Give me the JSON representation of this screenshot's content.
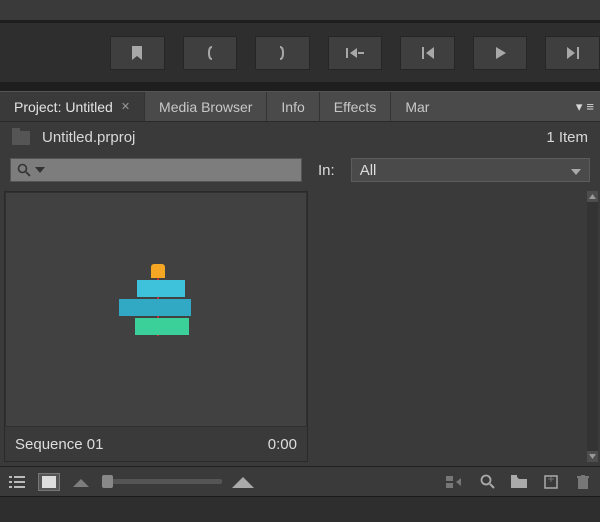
{
  "toolbar": {
    "buttons": [
      "marker",
      "brace-open",
      "brace-close",
      "step-back",
      "prev-frame",
      "play",
      "next-frame"
    ]
  },
  "tabs": {
    "items": [
      {
        "label": "Project: Untitled",
        "active": true,
        "closable": true
      },
      {
        "label": "Media Browser",
        "active": false
      },
      {
        "label": "Info",
        "active": false
      },
      {
        "label": "Effects",
        "active": false
      },
      {
        "label": "Mar",
        "active": false
      }
    ]
  },
  "panel": {
    "project_file": "Untitled.prproj",
    "item_count_label": "1 Item"
  },
  "search": {
    "placeholder": "",
    "in_label": "In:",
    "in_value": "All"
  },
  "items": [
    {
      "name": "Sequence 01",
      "duration": "0:00",
      "type": "sequence"
    }
  ],
  "bottom": {
    "view_mode": "icon"
  }
}
